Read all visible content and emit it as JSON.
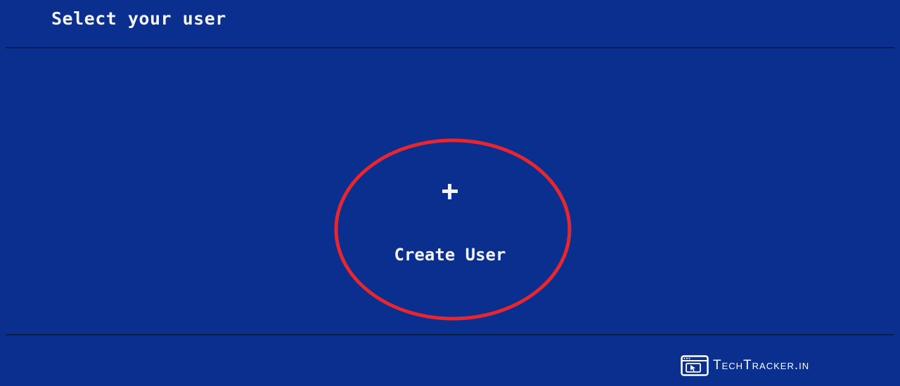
{
  "header": {
    "title": "Select your user"
  },
  "create_user": {
    "icon": "plus-icon",
    "label": "Create User"
  },
  "annotation": {
    "shape": "ellipse",
    "color": "#e8262f",
    "target": "create-user-tile"
  },
  "watermark": {
    "icon": "browser-window-cursor-icon",
    "text": "TechTracker.in"
  },
  "colors": {
    "background": "#0b2f8e",
    "text": "#f2f4f8",
    "divider": "#0a1a3a"
  }
}
